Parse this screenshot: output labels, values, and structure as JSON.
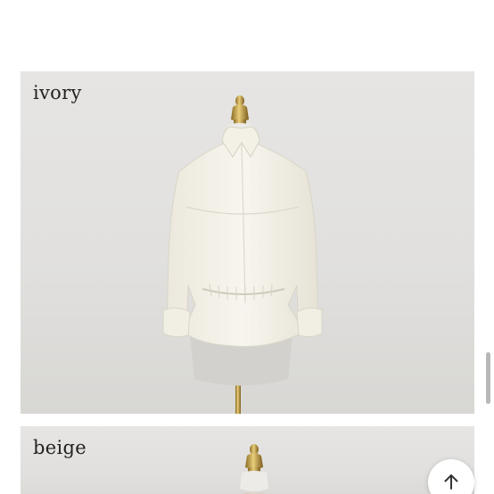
{
  "product_images": [
    {
      "color_label": "ivory",
      "garment_color": "#f4f1e8"
    },
    {
      "color_label": "beige",
      "garment_color": "#ebe3d3"
    }
  ],
  "scroll_top_button": {
    "icon": "arrow-up-icon"
  },
  "colors": {
    "background": "#ffffff",
    "photo_backdrop": "#e3e2e0",
    "label_text": "#222222",
    "brass_stand": "#c9a447"
  }
}
